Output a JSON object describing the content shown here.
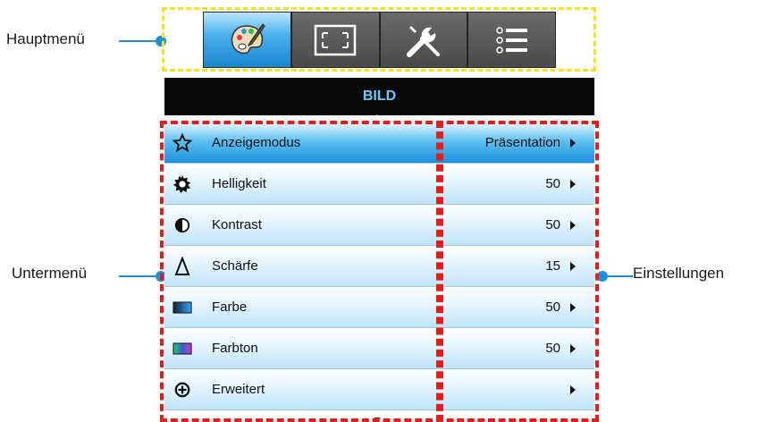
{
  "callouts": {
    "main_menu": "Hauptmenü",
    "submenu": "Untermenü",
    "settings": "Einstellungen"
  },
  "tabs": [
    {
      "icon": "palette-icon",
      "active": true
    },
    {
      "icon": "screen-resize-icon",
      "active": false
    },
    {
      "icon": "tools-icon",
      "active": false
    },
    {
      "icon": "list-icon",
      "active": false
    }
  ],
  "title": "BILD",
  "items": [
    {
      "label": "Anzeigemodus",
      "value": "Präsentation",
      "icon": "star-icon",
      "active": true
    },
    {
      "label": "Helligkeit",
      "value": "50",
      "icon": "brightness-icon",
      "active": false
    },
    {
      "label": "Kontrast",
      "value": "50",
      "icon": "contrast-icon",
      "active": false
    },
    {
      "label": "Schärfe",
      "value": "15",
      "icon": "sharpness-icon",
      "active": false
    },
    {
      "label": "Farbe",
      "value": "50",
      "icon": "color-icon",
      "active": false
    },
    {
      "label": "Farbton",
      "value": "50",
      "icon": "tint-icon",
      "active": false
    },
    {
      "label": "Erweitert",
      "value": "",
      "icon": "advanced-icon",
      "active": false
    }
  ],
  "colors": {
    "callout_line": "#1e8fd8",
    "highlight_main": "#f4e21b",
    "highlight_sub": "#e41c1c",
    "title_text": "#6fc8ff"
  }
}
